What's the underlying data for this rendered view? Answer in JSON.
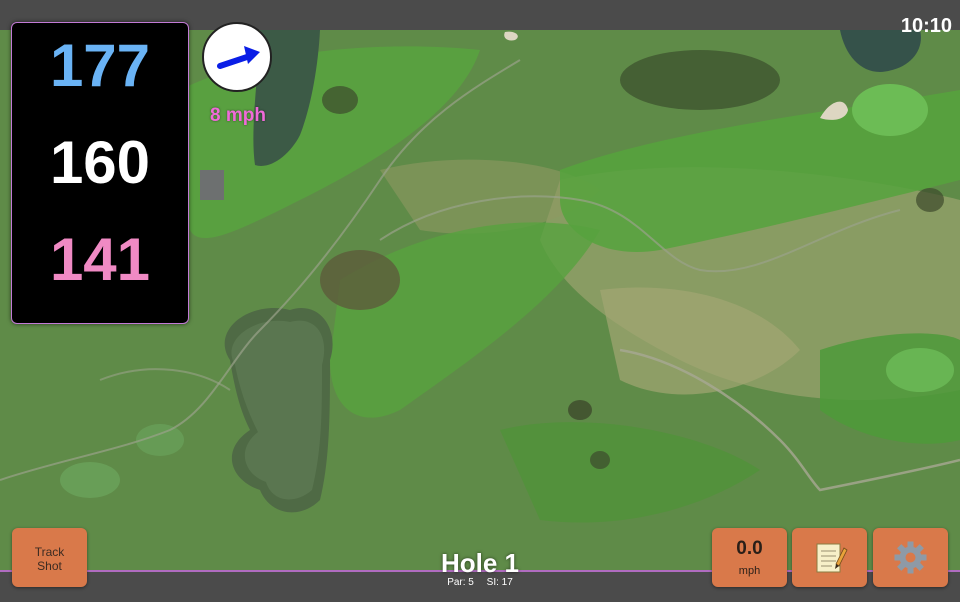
{
  "status_bar": {
    "time": "10:10"
  },
  "yardages": {
    "back": "177",
    "middle": "160",
    "front": "141"
  },
  "wind": {
    "speed": "8 mph",
    "arrow_icon": "wind-arrow-icon"
  },
  "hole": {
    "title": "Hole 1",
    "par": "Par: 5",
    "si": "SI: 17"
  },
  "buttons": {
    "track_line1": "Track",
    "track_line2": "Shot",
    "speed_value": "0.0",
    "speed_unit": "mph",
    "notes_icon": "notepad-icon",
    "settings_icon": "gear-icon"
  },
  "colors": {
    "back_yardage": "#6ab3f5",
    "middle_yardage": "#ffffff",
    "front_yardage": "#f08ac4",
    "wind_text": "#f06ad9",
    "button": "#d9794a"
  }
}
